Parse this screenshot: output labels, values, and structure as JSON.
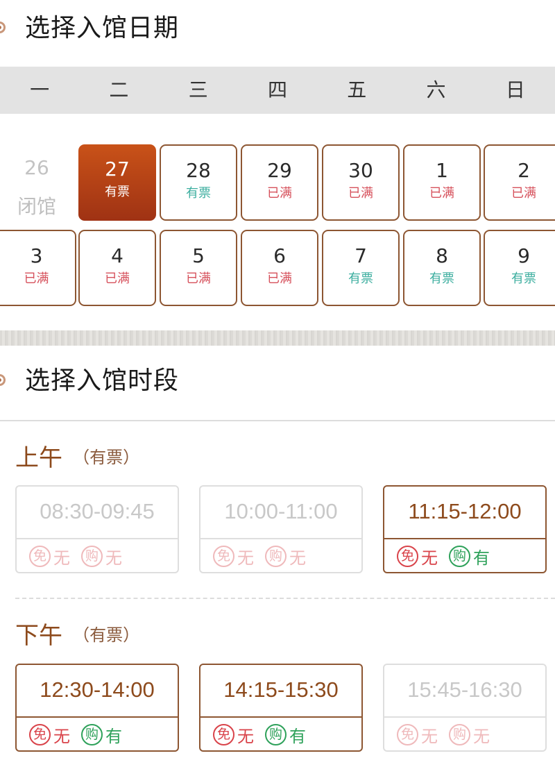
{
  "date_section": {
    "title": "选择入馆日期"
  },
  "weekdays": [
    "一",
    "二",
    "三",
    "四",
    "五",
    "六",
    "日"
  ],
  "calendar": {
    "week1": [
      {
        "day": "26",
        "status": "闭馆",
        "state": "closed"
      },
      {
        "day": "27",
        "status": "有票",
        "state": "selected"
      },
      {
        "day": "28",
        "status": "有票",
        "state": "available"
      },
      {
        "day": "29",
        "status": "已满",
        "state": "full"
      },
      {
        "day": "30",
        "status": "已满",
        "state": "full"
      },
      {
        "day": "1",
        "status": "已满",
        "state": "full"
      },
      {
        "day": "2",
        "status": "已满",
        "state": "full"
      }
    ],
    "week2": [
      {
        "day": "3",
        "status": "已满",
        "state": "full"
      },
      {
        "day": "4",
        "status": "已满",
        "state": "full"
      },
      {
        "day": "5",
        "status": "已满",
        "state": "full"
      },
      {
        "day": "6",
        "status": "已满",
        "state": "full"
      },
      {
        "day": "7",
        "status": "有票",
        "state": "available"
      },
      {
        "day": "8",
        "status": "有票",
        "state": "available"
      },
      {
        "day": "9",
        "status": "有票",
        "state": "available"
      }
    ]
  },
  "time_section": {
    "title": "选择入馆时段"
  },
  "morning": {
    "label": "上午",
    "status": "（有票）",
    "slots": [
      {
        "time": "08:30-09:45",
        "free_icon": "免",
        "free": "无",
        "buy_icon": "购",
        "buy": "无",
        "enabled": false
      },
      {
        "time": "10:00-11:00",
        "free_icon": "免",
        "free": "无",
        "buy_icon": "购",
        "buy": "无",
        "enabled": false
      },
      {
        "time": "11:15-12:00",
        "free_icon": "免",
        "free": "无",
        "buy_icon": "购",
        "buy": "有",
        "enabled": true
      }
    ]
  },
  "afternoon": {
    "label": "下午",
    "status": "（有票）",
    "slots": [
      {
        "time": "12:30-14:00",
        "free_icon": "免",
        "free": "无",
        "buy_icon": "购",
        "buy": "有",
        "enabled": true
      },
      {
        "time": "14:15-15:30",
        "free_icon": "免",
        "free": "无",
        "buy_icon": "购",
        "buy": "有",
        "enabled": true
      },
      {
        "time": "15:45-16:30",
        "free_icon": "免",
        "free": "无",
        "buy_icon": "购",
        "buy": "无",
        "enabled": false
      }
    ]
  },
  "colors": {
    "accent": "#8d4a1c",
    "selected_gradient_top": "#c95218",
    "selected_gradient_bottom": "#9f3214",
    "full": "#d6505b",
    "available": "#3cae9f"
  }
}
